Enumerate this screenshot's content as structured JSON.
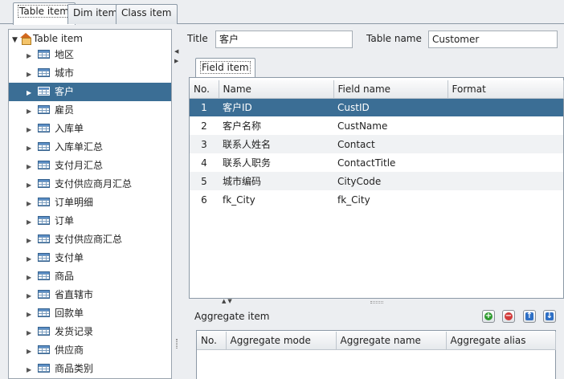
{
  "top_tabs": [
    {
      "label": "Table item"
    },
    {
      "label": "Dim item"
    },
    {
      "label": "Class item"
    }
  ],
  "tree": {
    "root_label": "Table item",
    "items": [
      {
        "label": "地区"
      },
      {
        "label": "城市"
      },
      {
        "label": "客户"
      },
      {
        "label": "雇员"
      },
      {
        "label": "入库单"
      },
      {
        "label": "入库单汇总"
      },
      {
        "label": "支付月汇总"
      },
      {
        "label": "支付供应商月汇总"
      },
      {
        "label": "订单明细"
      },
      {
        "label": "订单"
      },
      {
        "label": "支付供应商汇总"
      },
      {
        "label": "支付单"
      },
      {
        "label": "商品"
      },
      {
        "label": "省直辖市"
      },
      {
        "label": "回款单"
      },
      {
        "label": "发货记录"
      },
      {
        "label": "供应商"
      },
      {
        "label": "商品类别"
      }
    ]
  },
  "form": {
    "title_label": "Title",
    "title_value": "客户",
    "table_name_label": "Table name",
    "table_name_value": "Customer"
  },
  "field_tab": {
    "label": "Field item"
  },
  "field_table": {
    "headers": [
      "No.",
      "Name",
      "Field name",
      "Format"
    ],
    "rows": [
      {
        "no": "1",
        "name": "客户ID",
        "field": "CustID",
        "format": ""
      },
      {
        "no": "2",
        "name": "客户名称",
        "field": "CustName",
        "format": ""
      },
      {
        "no": "3",
        "name": "联系人姓名",
        "field": "Contact",
        "format": ""
      },
      {
        "no": "4",
        "name": "联系人职务",
        "field": "ContactTitle",
        "format": ""
      },
      {
        "no": "5",
        "name": "城市编码",
        "field": "CityCode",
        "format": ""
      },
      {
        "no": "6",
        "name": "fk_City",
        "field": "fk_City",
        "format": ""
      }
    ]
  },
  "aggregate": {
    "title": "Aggregate item",
    "headers": [
      "No.",
      "Aggregate mode",
      "Aggregate name",
      "Aggregate alias"
    ]
  },
  "colors": {
    "selection": "#3b6e95",
    "add": "#2e9a2e",
    "remove": "#d23a3a",
    "move": "#2e6fc5"
  }
}
